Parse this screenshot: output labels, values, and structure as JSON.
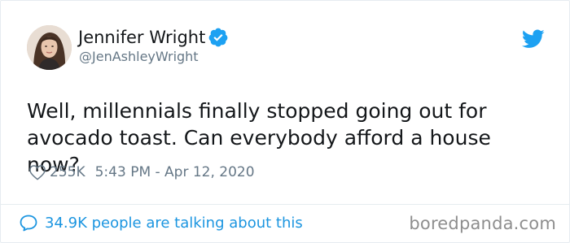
{
  "tweet": {
    "author": {
      "display_name": "Jennifer Wright",
      "handle": "@JenAshleyWright",
      "verified": true
    },
    "text": "Well, millennials finally stopped going out for avocado toast. Can everybody afford a house now?",
    "likes": "255K",
    "timestamp": "5:43 PM - Apr 12, 2020",
    "conversation": "34.9K people are talking about this"
  },
  "icons": {
    "platform": "twitter-bird-icon",
    "like": "heart-icon",
    "reply": "speech-bubble-icon",
    "verified": "verified-badge-icon"
  },
  "colors": {
    "brand_blue": "#1da1f2",
    "link_blue": "#1b95e0",
    "text_primary": "#14171a",
    "text_secondary": "#657786"
  },
  "watermark": "boredpanda.com"
}
